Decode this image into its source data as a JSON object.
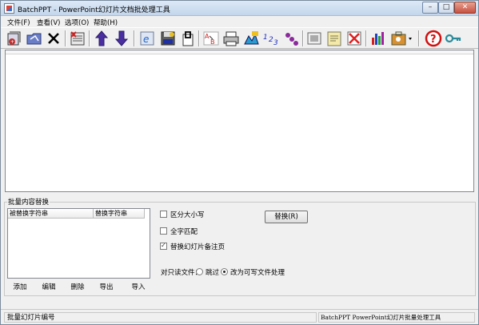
{
  "window": {
    "title": "BatchPPT - PowerPoint幻灯片文档批处理工具",
    "controls": {
      "minimize": "–",
      "maximize": "□",
      "close": "✕"
    }
  },
  "menu": {
    "items": [
      {
        "label": "文件(F)"
      },
      {
        "label": "查看(V)"
      },
      {
        "label": "选项(O)"
      },
      {
        "label": "帮助(H)"
      }
    ]
  },
  "toolbar": {
    "buttons": [
      "add-files-icon",
      "add-folder-icon",
      "delete-icon",
      "remove-list-icon",
      "move-up-icon",
      "move-down-icon",
      "browser-icon",
      "save-icon",
      "open-icon",
      "replace-text-icon",
      "print-icon",
      "image-icon",
      "numbering-icon",
      "link-icon",
      "slide-icon",
      "notes-icon",
      "clear-icon",
      "statistics-icon",
      "toolbox-icon",
      "help-icon",
      "key-icon"
    ]
  },
  "batch_replace": {
    "group_label": "批量内容替换",
    "table": {
      "col_find": "被替换字符串",
      "col_replace": "替换字符串"
    },
    "buttons": {
      "add": "添加",
      "edit": "编辑",
      "delete": "删除",
      "export": "导出",
      "import": "导入"
    },
    "options": {
      "match_case": {
        "label": "区分大小写",
        "checked": false
      },
      "whole_word": {
        "label": "全字匹配",
        "checked": false
      },
      "replace_notes": {
        "label": "替换幻灯片备注页",
        "checked": true
      }
    },
    "replace_button": "替换(R)",
    "readonly": {
      "label": "对只读文件：",
      "skip": "跳过",
      "make_writable": "改为可写文件处理",
      "selected": "make_writable"
    }
  },
  "status": {
    "left": "批量幻灯片编号",
    "right": "BatchPPT PowerPoint幻灯片批量处理工具"
  }
}
